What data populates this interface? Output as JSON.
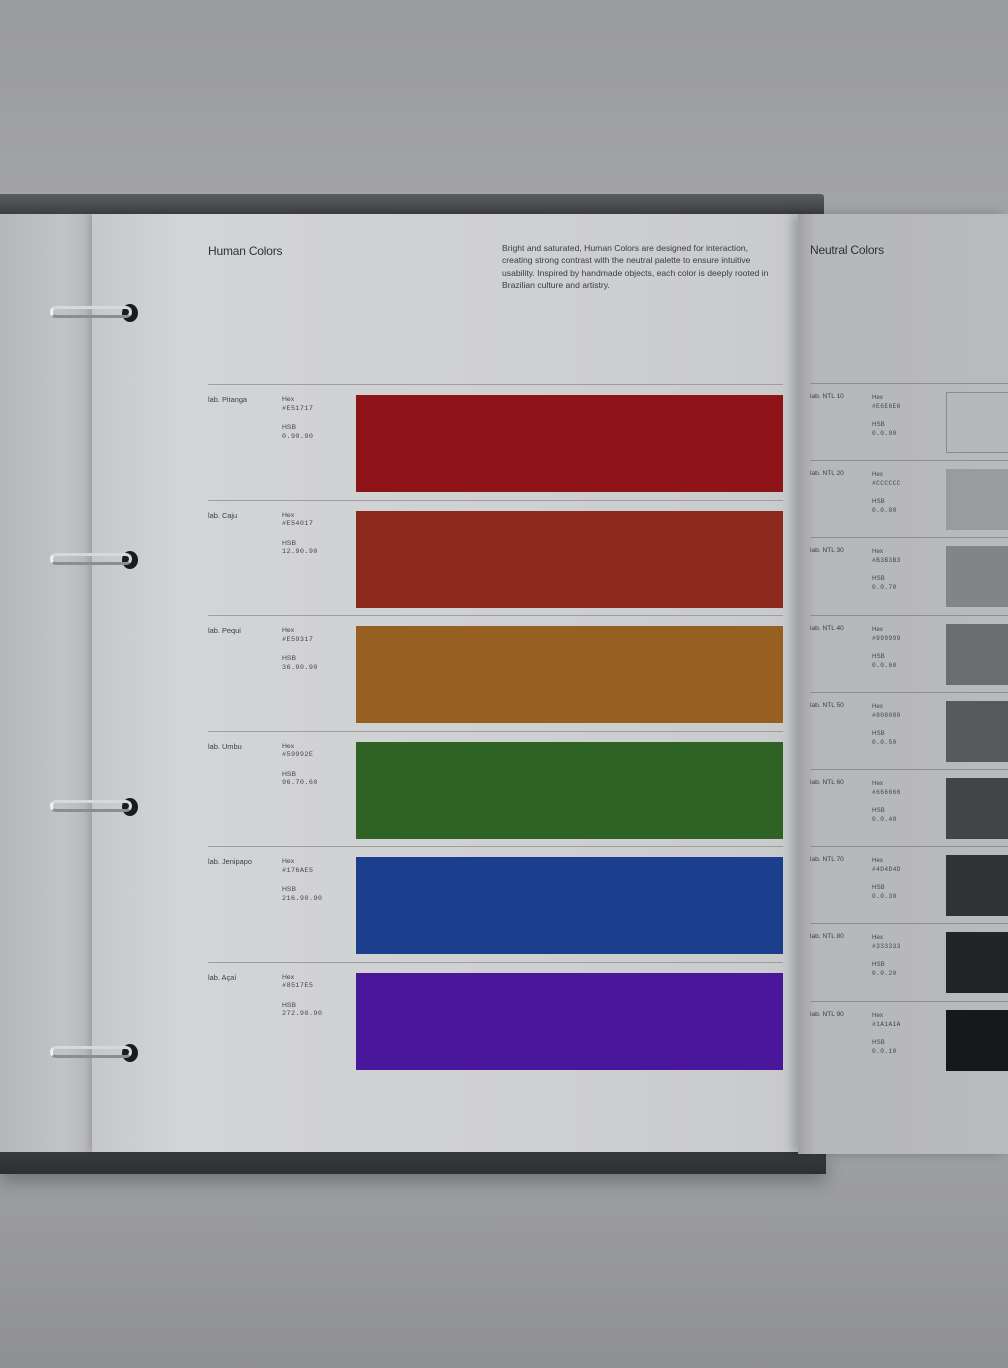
{
  "human": {
    "title": "Human Colors",
    "description": "Bright and saturated, Human Colors are designed for interaction, creating strong contrast with the neutral palette to ensure intuitive usability. Inspired by handmade objects, each color is deeply rooted in Brazilian culture and artistry.",
    "hex_label": "Hex",
    "hsb_label": "HSB",
    "rows": [
      {
        "name": "lab. Pitanga",
        "hex": "#E51717",
        "hsb": "0.90.90",
        "color": "#8e1419"
      },
      {
        "name": "lab. Caju",
        "hex": "#E54017",
        "hsb": "12.90.90",
        "color": "#8b2a1c"
      },
      {
        "name": "lab. Pequi",
        "hex": "#E59317",
        "hsb": "36.90.90",
        "color": "#976020"
      },
      {
        "name": "lab. Umbu",
        "hex": "#59992E",
        "hsb": "96.70.60",
        "color": "#2f6326"
      },
      {
        "name": "lab. Jenipapo",
        "hex": "#176AE5",
        "hsb": "216.90.90",
        "color": "#1c3f8d"
      },
      {
        "name": "lab. Açaí",
        "hex": "#8517E5",
        "hsb": "272.90.90",
        "color": "#4a179b"
      }
    ]
  },
  "neutral": {
    "title": "Neutral Colors",
    "hex_label": "Hex",
    "hsb_label": "HSB",
    "rows": [
      {
        "name": "lab. NTL 10",
        "hex": "#E6E6E6",
        "hsb": "0.0.90",
        "color": "#b7b8ba"
      },
      {
        "name": "lab. NTL 20",
        "hex": "#CCCCCC",
        "hsb": "0.0.80",
        "color": "#9a9b9d"
      },
      {
        "name": "lab. NTL 30",
        "hex": "#B3B3B3",
        "hsb": "0.0.70",
        "color": "#838486"
      },
      {
        "name": "lab. NTL 40",
        "hex": "#999999",
        "hsb": "0.0.60",
        "color": "#6c6d70"
      },
      {
        "name": "lab. NTL 50",
        "hex": "#808080",
        "hsb": "0.0.50",
        "color": "#58595c"
      },
      {
        "name": "lab. NTL 60",
        "hex": "#666666",
        "hsb": "0.0.40",
        "color": "#434447"
      },
      {
        "name": "lab. NTL 70",
        "hex": "#4D4D4D",
        "hsb": "0.0.30",
        "color": "#313235"
      },
      {
        "name": "lab. NTL 80",
        "hex": "#333333",
        "hsb": "0.0.20",
        "color": "#232426"
      },
      {
        "name": "lab. NTL 90",
        "hex": "#1A1A1A",
        "hsb": "0.0.10",
        "color": "#17181a"
      }
    ]
  }
}
